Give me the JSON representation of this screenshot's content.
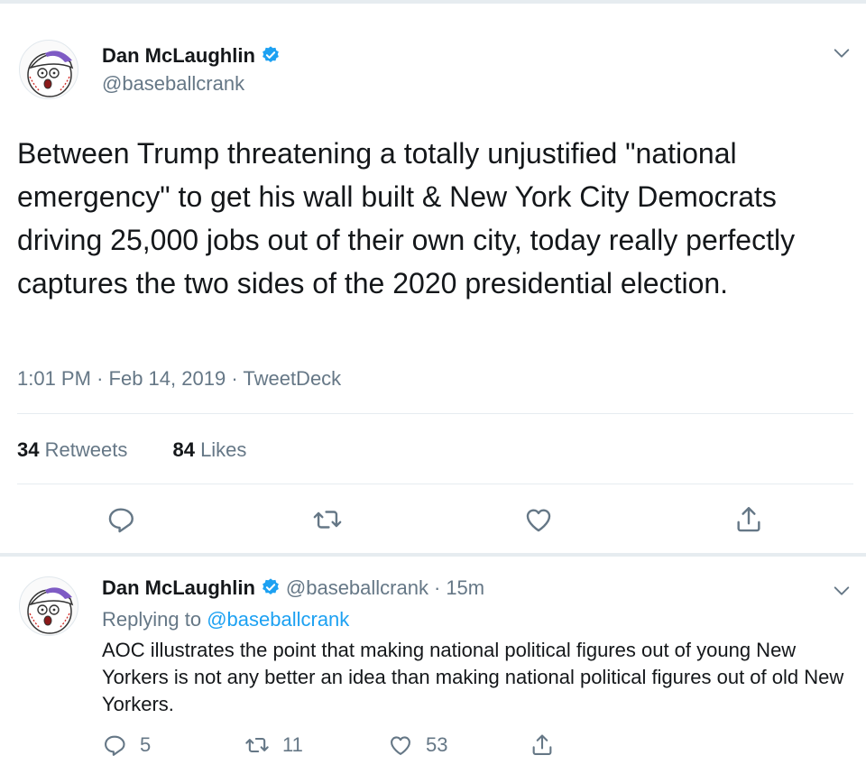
{
  "tweet": {
    "author_name": "Dan McLaughlin",
    "author_handle": "@baseballcrank",
    "text": "Between Trump threatening a totally unjustified \"national emergency\" to get his wall built & New York City Democrats driving 25,000 jobs out of their own city, today really perfectly captures the two sides of the 2020 presidential election.",
    "time": "1:01 PM",
    "date": "Feb 14, 2019",
    "source": "TweetDeck",
    "retweets_count": "34",
    "retweets_label": "Retweets",
    "likes_count": "84",
    "likes_label": "Likes",
    "actions": [
      "reply-icon",
      "retweet-icon",
      "like-icon",
      "share-icon"
    ]
  },
  "reply": {
    "author_name": "Dan McLaughlin",
    "author_handle": "@baseballcrank",
    "time_ago": "15m",
    "replying_prefix": "Replying to",
    "replying_to": "@baseballcrank",
    "text": "AOC illustrates the point that making national political figures out of young New Yorkers is not any better an idea than making national political figures out of old New Yorkers.",
    "reply_count": "5",
    "retweet_count": "11",
    "like_count": "53"
  },
  "colors": {
    "accent": "#1da1f2",
    "secondary_text": "#657786",
    "primary_text": "#14171a",
    "background": "#e6ecf0",
    "card": "#ffffff"
  }
}
